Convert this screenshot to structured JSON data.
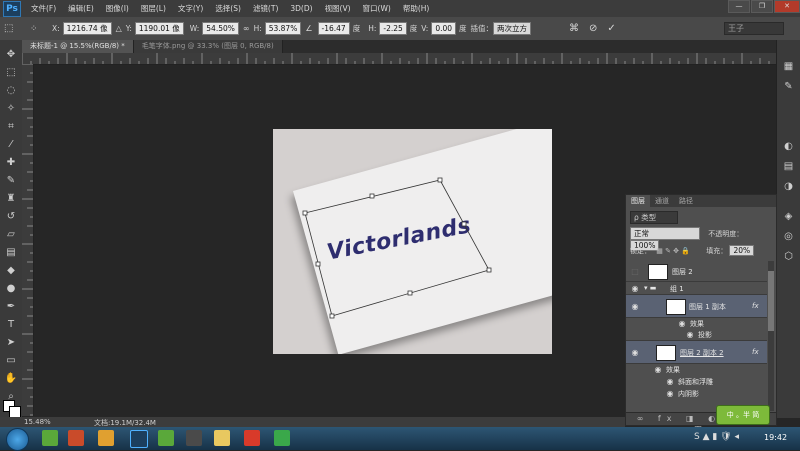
{
  "app": {
    "logo": "Ps"
  },
  "menu": [
    "文件(F)",
    "编辑(E)",
    "图像(I)",
    "图层(L)",
    "文字(Y)",
    "选择(S)",
    "滤镜(T)",
    "3D(D)",
    "视图(V)",
    "窗口(W)",
    "帮助(H)"
  ],
  "options": {
    "x_label": "X:",
    "x_value": "1216.74 像",
    "y_label": "Y:",
    "y_value": "1190.01 像",
    "w_label": "W:",
    "w_value": "54.50%",
    "h_label": "H:",
    "h_value": "53.87%",
    "angle_value": "-16.47",
    "angle_unit": "度",
    "hskew_label": "H:",
    "hskew_value": "-2.25",
    "hskew_unit": "度",
    "vskew_label": "V:",
    "vskew_value": "0.00",
    "vskew_unit": "度",
    "interp_label": "插值：",
    "interp_value": "两次立方",
    "workspace": "王子"
  },
  "tabs": [
    {
      "label": "未标题-1 @ 15.5%(RGB/8) *",
      "active": true
    },
    {
      "label": "毛笔字体.png @ 33.3% (图层 0, RGB/8)",
      "active": false
    }
  ],
  "canvas": {
    "logo_text": "Victorlands"
  },
  "layers_panel": {
    "tabs": [
      "图层",
      "通道",
      "路径"
    ],
    "filter_label": "ρ 类型",
    "blend_mode": "正常",
    "opacity_label": "不透明度：",
    "opacity_value": "100%",
    "lock_label": "锁定：",
    "fill_label": "填充：",
    "fill_value": "20%",
    "layers": [
      {
        "name": "图层 2"
      },
      {
        "name": "组 1"
      },
      {
        "name": "图层 1 副本",
        "fx": "fx"
      },
      {
        "name": "效果"
      },
      {
        "name": "投影"
      },
      {
        "name": "图层 2 副本 2",
        "fx": "fx"
      },
      {
        "name": "效果"
      },
      {
        "name": "斜面和浮雕"
      },
      {
        "name": "内阴影"
      }
    ]
  },
  "status": {
    "zoom": "15.48%",
    "doc": "文档:19.1M/32.4M"
  },
  "taskbar": {
    "time": "19:42",
    "ime": "中 。半 简"
  }
}
